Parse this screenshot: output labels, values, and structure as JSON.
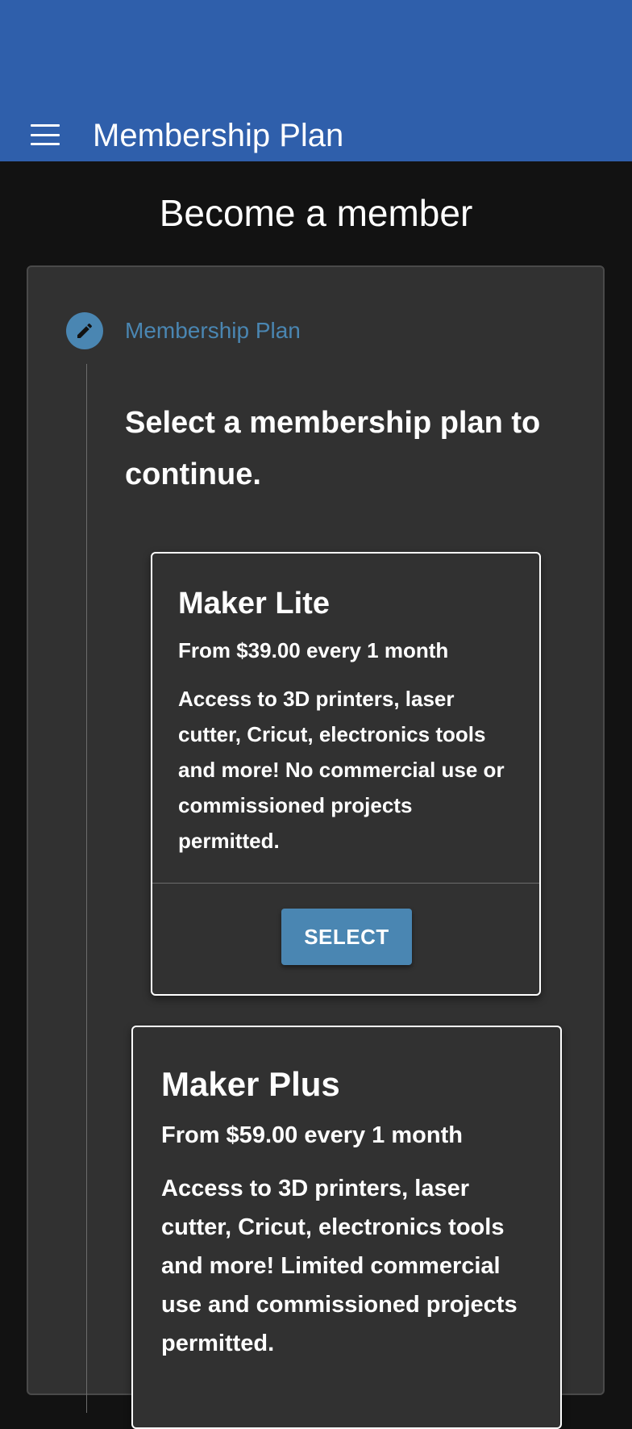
{
  "app_bar": {
    "title": "Membership Plan",
    "menu_icon": "hamburger-menu-icon",
    "background": "#2f5fab"
  },
  "page": {
    "heading": "Become a member"
  },
  "stepper": {
    "step_icon": "pencil-icon",
    "step_label": "Membership Plan",
    "accent": "#4a86b2",
    "instruction": "Select a membership plan to continue."
  },
  "plans": [
    {
      "name": "Maker Lite",
      "price": "From $39.00 every 1 month",
      "description": "Access to 3D printers, laser cutter, Cricut, electronics tools and more! No commercial use or commissioned projects permitted.",
      "button_label": "SELECT"
    },
    {
      "name": "Maker Plus",
      "price": "From $59.00 every 1 month",
      "description": "Access to 3D printers, laser cutter, Cricut, electronics tools and more! Limited commercial use and commissioned projects permitted."
    }
  ]
}
